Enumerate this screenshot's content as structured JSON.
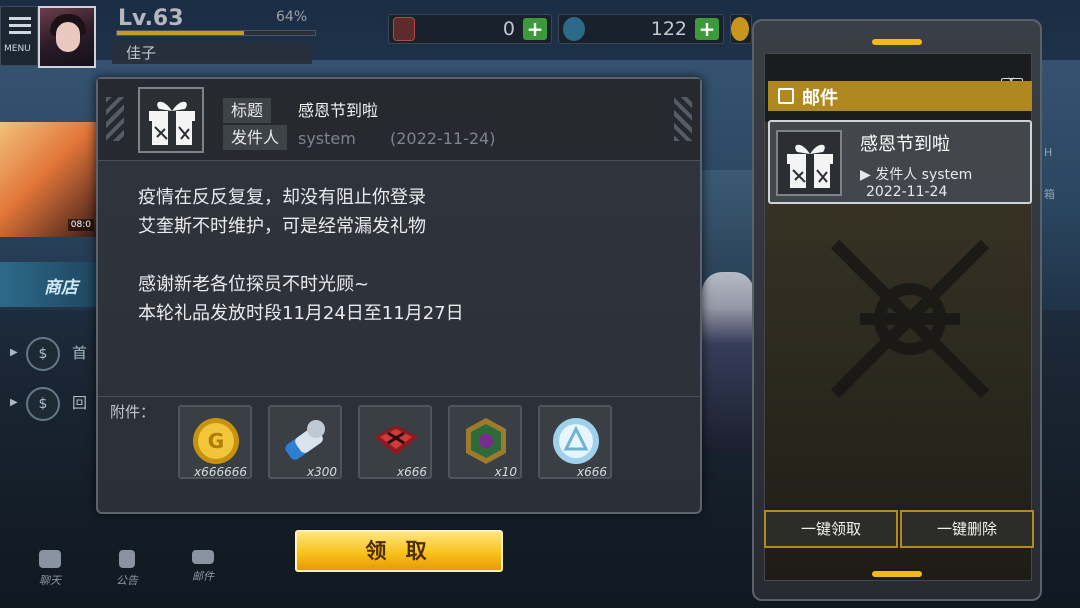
{
  "hud": {
    "menu_label": "MENU",
    "level": "Lv.63",
    "level_progress": "64%",
    "level_progress_fraction": 0.64,
    "player_name": "佳子",
    "resources": [
      {
        "name": "stamina",
        "value": "0",
        "plus": "+"
      },
      {
        "name": "diamond",
        "value": "122",
        "plus": "+"
      }
    ]
  },
  "background": {
    "banner_time": "08:0",
    "shop_label": "商店",
    "side_buttons": [
      {
        "label": "首"
      },
      {
        "label": "回"
      }
    ],
    "right_edge": [
      "H",
      "箱"
    ]
  },
  "bottom_nav": [
    {
      "label": "聊天",
      "icon": "chat-icon"
    },
    {
      "label": "公告",
      "icon": "announcement-icon"
    },
    {
      "label": "邮件",
      "icon": "mail-icon"
    }
  ],
  "mail_detail": {
    "subject_tag": "标题",
    "subject": "感恩节到啦",
    "sender_tag": "发件人",
    "sender": "system",
    "date": "(2022-11-24)",
    "body": [
      "疫情在反反复复，却没有阻止你登录",
      "艾奎斯不时维护，可是经常漏发礼物",
      "感谢新老各位探员不时光顾~",
      "本轮礼品发放时段11月24日至11月27日"
    ],
    "attachments_label": "附件：",
    "attachments": [
      {
        "icon": "gold-coin-icon",
        "qty": "x666666"
      },
      {
        "icon": "stamina-ticket-icon",
        "qty": "x300"
      },
      {
        "icon": "red-chip-icon",
        "qty": "x666"
      },
      {
        "icon": "green-medal-icon",
        "qty": "x10"
      },
      {
        "icon": "crystal-coin-icon",
        "qty": "x666"
      }
    ],
    "claim_button": "领 取"
  },
  "mailbox": {
    "title": "邮件",
    "items": [
      {
        "subject": "感恩节到啦",
        "sender_line": "▶  发件人 system",
        "date": "2022-11-24"
      }
    ],
    "claim_all": "一键领取",
    "delete_all": "一键删除"
  },
  "colors": {
    "accent_yellow": "#f3b81a",
    "plus_green": "#3c9a3a",
    "panel_bg": "#2b3038"
  }
}
